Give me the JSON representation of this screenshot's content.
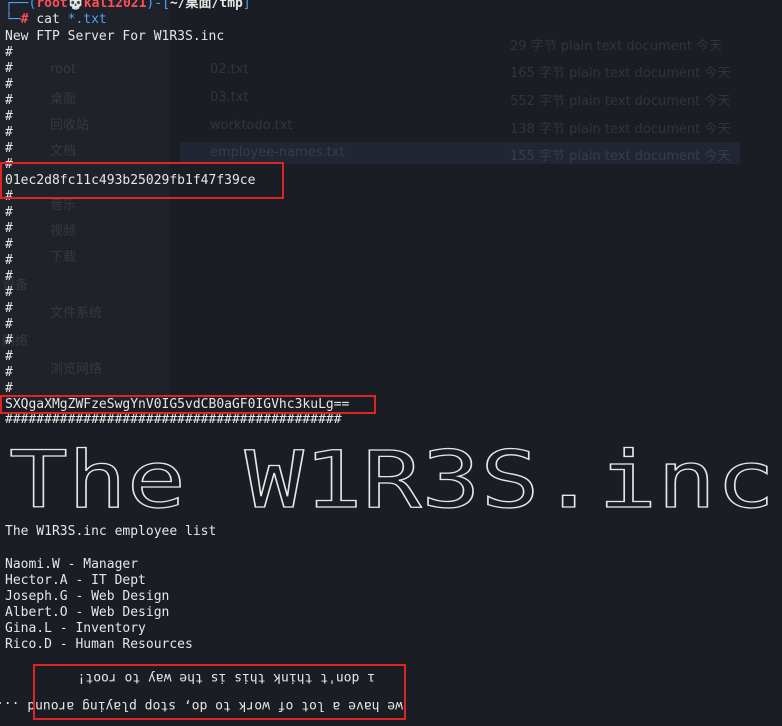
{
  "prompt": {
    "line1_prefix": "┌──(",
    "user_host": "root💀kali2021",
    "line1_mid": ")-[",
    "cwd": "~/桌面/tmp",
    "line1_suffix": "]",
    "line2_prefix": "└─",
    "hash": "# ",
    "command": "cat ",
    "glob": "*.txt"
  },
  "output": {
    "ftp_title": "New FTP Server For W1R3S.inc",
    "hash_char": "#",
    "md5_hash": "01ec2d8fc11c493b25029fb1f47f39ce",
    "base64_string": "SXQgaXMgZWFzeSwgYnV0IG5vdCB0aGF0IGVhc3kuLg==",
    "hash_rule": "###########################################",
    "banner_text": "The W1R3S.inc",
    "employee_list_title": "The W1R3S.inc employee list",
    "employees": [
      "Naomi.W - Manager",
      "Hector.A - IT Dept",
      "Joseph.G - Web Design",
      "Albert.O - Web Design",
      "Gina.L - Inventory",
      "Rico.D - Human Resources"
    ],
    "upside_down_line1": "ı don't think this is the way to root!",
    "upside_down_line2": "we have a lot of work to do, stop playing around ..."
  },
  "background_ghost": {
    "files": [
      {
        "name": "",
        "info": "29 字节  plain text document  今天"
      },
      {
        "name": "02.txt",
        "info": "165 字节  plain text document  今天"
      },
      {
        "name": "03.txt",
        "info": "552 字节  plain text document  今天"
      },
      {
        "name": "worktodo.txt",
        "info": "138 字节  plain text document  今天"
      },
      {
        "name": "employee-names.txt",
        "info": "155 字节  plain text document  今天"
      }
    ],
    "sidebar": [
      "root",
      "桌面",
      "回收站",
      "文档",
      "音乐",
      "视频",
      "下载",
      "设备",
      "文件系统",
      "网络",
      "浏览网络"
    ]
  },
  "colors": {
    "background": "#1b1d24",
    "prompt_blue": "#4aa3ff",
    "prompt_red": "#ff4d5a",
    "highlight_box": "#e02424",
    "text": "#e6e6e6"
  }
}
